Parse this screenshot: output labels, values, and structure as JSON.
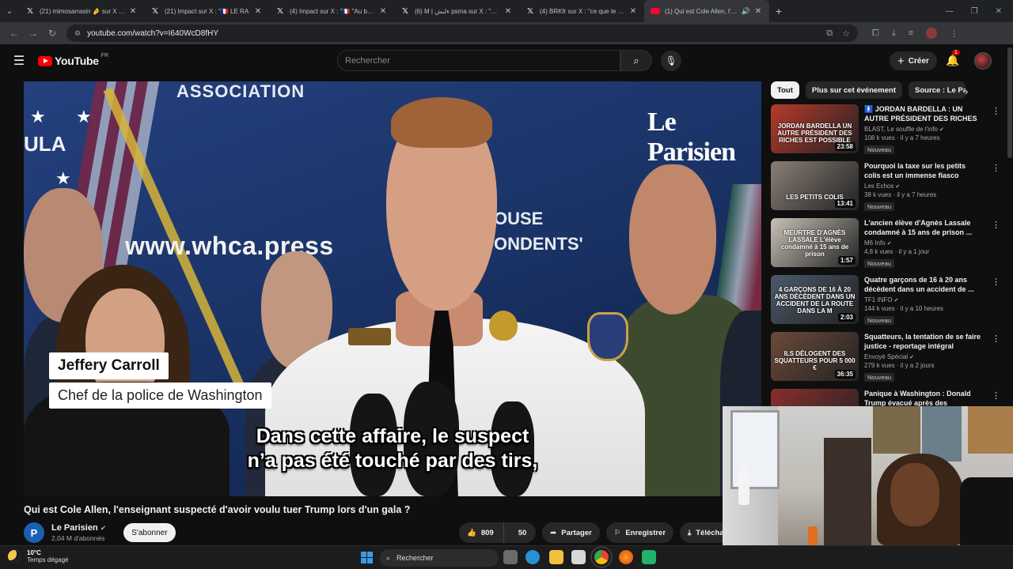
{
  "browser": {
    "tabs": [
      {
        "title": "(21) mimosarrasin 🤌 sur X : \"C",
        "icon": "x-logo"
      },
      {
        "title": "(21) Impact sur X : \"🇫🇷 LE RA",
        "icon": "x-logo"
      },
      {
        "title": "(4) Impact sur X : \"🇫🇷 \"Au bout d",
        "icon": "x-logo"
      },
      {
        "title": "(6) M | ‏ءلىش psma sur X : \"Mais c",
        "icon": "x-logo"
      },
      {
        "title": "(4) BRKfr sur X : \"ce que le ma",
        "icon": "x-logo"
      },
      {
        "title": "(1) Qui est Cole Allen, l'ense",
        "icon": "youtube-logo",
        "active": true
      }
    ],
    "url": "youtube.com/watch?v=I640WcD8fHY"
  },
  "youtube": {
    "logo_text": "YouTube",
    "region": "FR",
    "search_placeholder": "Rechercher",
    "create_label": "Créer",
    "notif_count": "1"
  },
  "video": {
    "overlay": {
      "banner_top": "ASSOCIATION",
      "banner_left": "ULA",
      "website": "www.whca.press",
      "banner_right_1": "OUSE",
      "banner_right_2": "ONDENTS'",
      "channel_bug": "Le Parisien",
      "person_name": "Jeffery Carroll",
      "person_role": "Chef de la police de Washington",
      "subtitle_1": "Dans cette affaire, le suspect",
      "subtitle_2": "n’a pas été touché par des tirs,"
    },
    "title": "Qui est Cole Allen, l'enseignant suspecté d'avoir voulu tuer Trump lors d'un gala ?",
    "channel": {
      "name": "Le Parisien",
      "initial": "P",
      "subs": "2,04 M d'abonnés",
      "subscribe_label": "S'abonner"
    },
    "actions": {
      "likes": "809",
      "dislikes": "50",
      "share": "Partager",
      "save": "Enregistrer",
      "download": "Télécharger"
    }
  },
  "sidebar": {
    "chips": [
      "Tout",
      "Plus sur cet événement",
      "Source : Le Parisien"
    ],
    "recommendations": [
      {
        "title": "🚹 JORDAN BARDELLA : UN AUTRE PRÉSIDENT DES RICHES ?",
        "channel": "BLAST, Le souffle de l'info",
        "views": "108 k vues · il y a 7 heures",
        "duration": "23:58",
        "badge": "Nouveau",
        "thumb_text": "JORDAN BARDELLA UN AUTRE PRÉSIDENT DES RICHES EST POSSIBLE",
        "thumb_color": "#b73a2b"
      },
      {
        "title": "Pourquoi la taxe sur les petits colis est un immense fiasco",
        "channel": "Les Echos",
        "views": "38 k vues · il y a 7 heures",
        "duration": "13:41",
        "badge": "Nouveau",
        "thumb_text": "LES PETITS COLIS",
        "thumb_color": "#8a7f76"
      },
      {
        "title": "L'ancien élève d'Agnès Lassale condamné à 15 ans de prison ...",
        "channel": "M6 Info",
        "views": "4,8 k vues · il y a 1 jour",
        "duration": "1:57",
        "badge": "Nouveau",
        "thumb_text": "MEURTRE D'AGNÈS LASSALE L'élève condamné à 15 ans de prison",
        "thumb_color": "#c9c1b6"
      },
      {
        "title": "Quatre garçons de 16 à 20 ans décèdent dans un accident de ...",
        "channel": "TF1 INFO",
        "views": "144 k vues · il y a 10 heures",
        "duration": "2:03",
        "badge": "Nouveau",
        "thumb_text": "4 GARÇONS DE 16 À 20 ANS DÉCÈDENT DANS UN ACCIDENT DE LA ROUTE DANS LA M",
        "thumb_color": "#4b5a6a"
      },
      {
        "title": "Squatteurs, la tentation de se faire justice - reportage intégral",
        "channel": "Envoyé Spécial",
        "views": "279 k vues · il y a 2 jours",
        "duration": "36:35",
        "badge": "Nouveau",
        "thumb_text": "ILS DÉLOGENT DES SQUATTEURS POUR 5 000 €",
        "thumb_color": "#6d4a3a"
      },
      {
        "title": "Panique à Washington : Donald Trump évacué après des",
        "channel": "",
        "views": "",
        "duration": "",
        "badge": "",
        "thumb_text": "",
        "thumb_color": "#8a2e2e"
      }
    ]
  },
  "taskbar": {
    "temperature": "10°C",
    "weather": "Temps dégagé",
    "search_label": "Rechercher"
  }
}
